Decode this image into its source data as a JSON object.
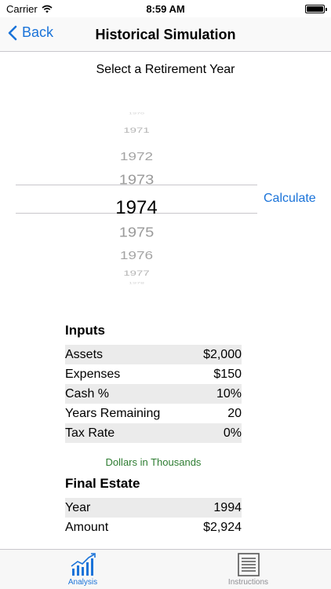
{
  "status_bar": {
    "carrier": "Carrier",
    "time": "8:59 AM"
  },
  "nav": {
    "back_label": "Back",
    "title": "Historical Simulation"
  },
  "prompt": "Select a Retirement Year",
  "picker": {
    "years": [
      "1970",
      "1971",
      "1972",
      "1973",
      "1974",
      "1975",
      "1976",
      "1977",
      "1978"
    ],
    "selected": "1974"
  },
  "calculate_label": "Calculate",
  "inputs": {
    "heading": "Inputs",
    "rows": [
      {
        "label": "Assets",
        "value": "$2,000"
      },
      {
        "label": "Expenses",
        "value": "$150"
      },
      {
        "label": "Cash %",
        "value": "10%"
      },
      {
        "label": "Years Remaining",
        "value": "20"
      },
      {
        "label": "Tax Rate",
        "value": "0%"
      }
    ]
  },
  "note": "Dollars in Thousands",
  "final_estate": {
    "heading": "Final Estate",
    "rows": [
      {
        "label": "Year",
        "value": "1994"
      },
      {
        "label": "Amount",
        "value": "$2,924"
      }
    ]
  },
  "tabs": [
    {
      "label": "Analysis",
      "icon": "chart-icon",
      "active": true
    },
    {
      "label": "Instructions",
      "icon": "document-icon",
      "active": false
    }
  ],
  "colors": {
    "accent": "#1a73d9",
    "note": "#2e7d32",
    "row_shade": "#ebebeb"
  }
}
